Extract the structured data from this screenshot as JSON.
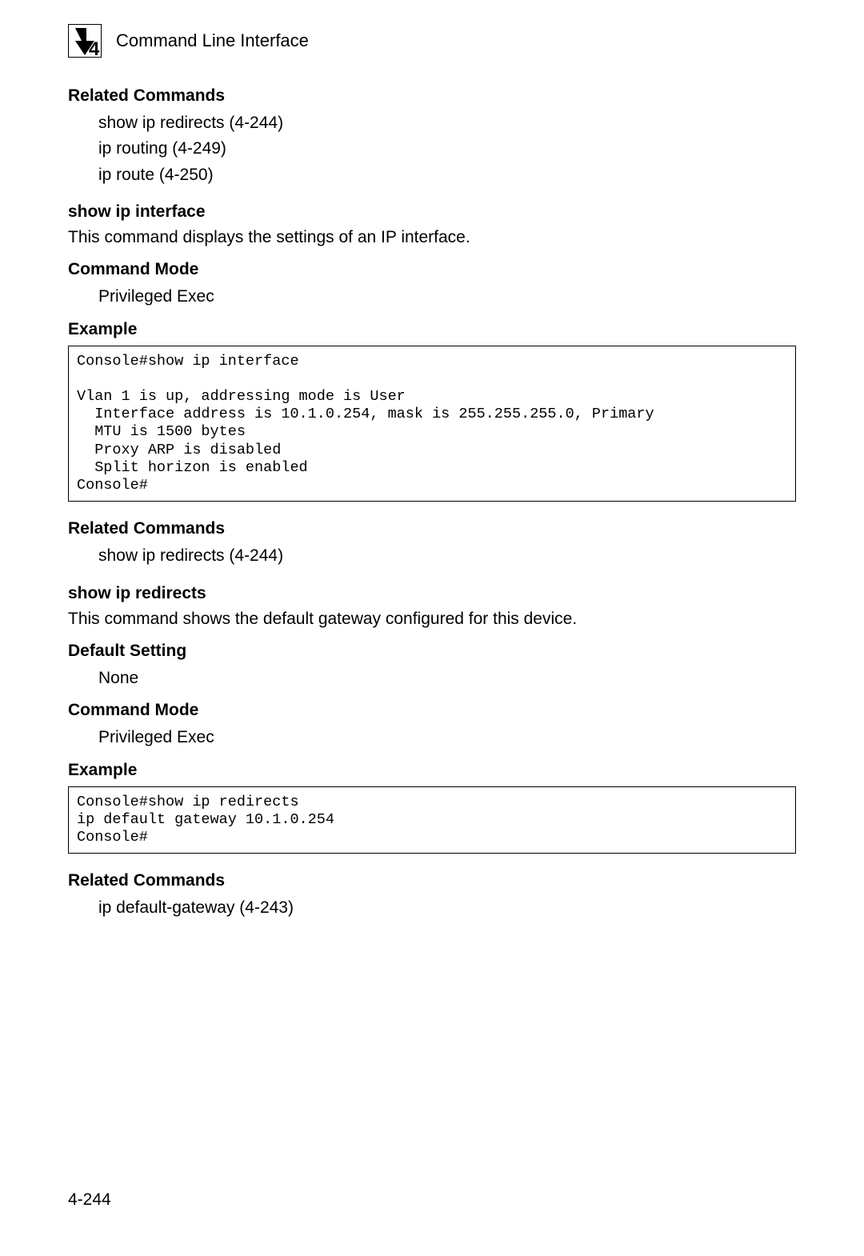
{
  "header": {
    "chapter_number": "4",
    "title": "Command Line Interface"
  },
  "sections": {
    "related1": {
      "heading": "Related Commands",
      "lines": [
        "show ip redirects (4-244)",
        "ip routing (4-249)",
        "ip route (4-250)"
      ]
    },
    "cmd1": {
      "heading": "show ip interface",
      "desc": "This command displays the settings of an IP interface."
    },
    "mode1": {
      "heading": "Command Mode",
      "value": "Privileged Exec"
    },
    "example1": {
      "heading": "Example",
      "code": "Console#show ip interface\n\nVlan 1 is up, addressing mode is User\n  Interface address is 10.1.0.254, mask is 255.255.255.0, Primary\n  MTU is 1500 bytes\n  Proxy ARP is disabled\n  Split horizon is enabled\nConsole#"
    },
    "related2": {
      "heading": "Related Commands",
      "lines": [
        "show ip redirects (4-244)"
      ]
    },
    "cmd2": {
      "heading": "show ip redirects",
      "desc": "This command shows the default gateway configured for this device."
    },
    "default2": {
      "heading": "Default Setting",
      "value": "None"
    },
    "mode2": {
      "heading": "Command Mode",
      "value": "Privileged Exec"
    },
    "example2": {
      "heading": "Example",
      "code": "Console#show ip redirects\nip default gateway 10.1.0.254\nConsole#"
    },
    "related3": {
      "heading": "Related Commands",
      "lines": [
        "ip default-gateway (4-243)"
      ]
    }
  },
  "page_number": "4-244"
}
